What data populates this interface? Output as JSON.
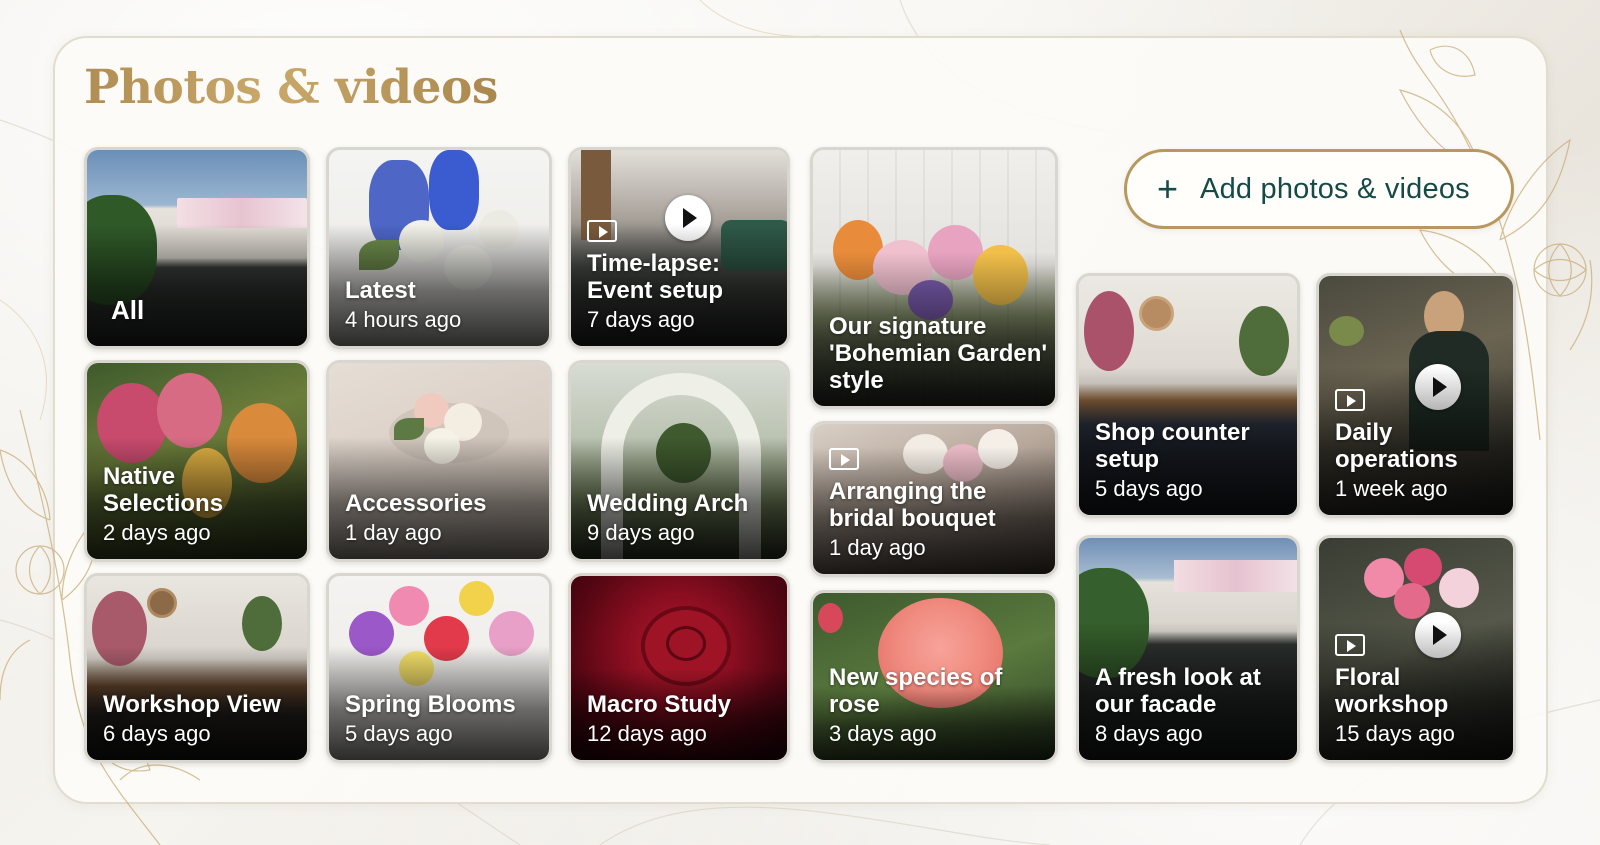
{
  "page": {
    "title": "Photos & videos"
  },
  "add_button": {
    "icon": "plus-icon",
    "label": "Add photos & videos"
  },
  "tiles": {
    "all": {
      "caption": "All",
      "time": ""
    },
    "latest": {
      "caption": "Latest",
      "time": "4 hours ago"
    },
    "timelapse": {
      "caption": "Time-lapse: Event setup",
      "time": "7 days ago",
      "video": true
    },
    "bohemian": {
      "caption": "Our signature 'Bohemian Garden' style",
      "time": ""
    },
    "native": {
      "caption": "Native Selections",
      "time": "2 days ago"
    },
    "accessories": {
      "caption": "Accessories",
      "time": "1 day ago"
    },
    "wedding_arch": {
      "caption": "Wedding Arch",
      "time": "9 days ago"
    },
    "bridal": {
      "caption": "Arranging the bridal bouquet",
      "time": "1 day ago",
      "video": true
    },
    "workshop_view": {
      "caption": "Workshop View",
      "time": "6 days ago"
    },
    "spring": {
      "caption": "Spring Blooms",
      "time": "5 days ago"
    },
    "macro": {
      "caption": "Macro Study",
      "time": "12 days ago"
    },
    "rose": {
      "caption": "New species of rose",
      "time": "3 days ago"
    },
    "shop_counter": {
      "caption": "Shop counter setup",
      "time": "5 days ago"
    },
    "daily_ops": {
      "caption": "Daily operations",
      "time": "1 week ago",
      "video": true
    },
    "facade": {
      "caption": "A fresh look at our facade",
      "time": "8 days ago"
    },
    "floral_workshop": {
      "caption": "Floral workshop",
      "time": "15 days ago",
      "video": true
    }
  },
  "colors": {
    "title_gold": "#b08d52",
    "button_border": "#b7985e",
    "button_text": "#154a46"
  }
}
